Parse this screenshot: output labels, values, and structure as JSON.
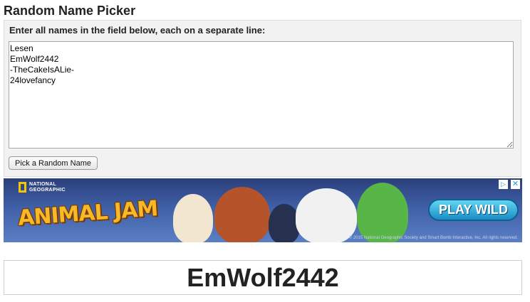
{
  "page": {
    "title": "Random Name Picker"
  },
  "picker": {
    "instructions": "Enter all names in the field below, each on a separate line:",
    "names_value": "Lesen\nEmWolf2442\n-TheCakeIsALie-\n24lovefancy",
    "button_label": "Pick a Random Name"
  },
  "ad": {
    "brand_badge": "NATIONAL GEOGRAPHIC",
    "logo_text": "ANIMAL JAM",
    "cta_label": "PLAY WILD",
    "adchoices_icon": "adchoices-icon",
    "close_icon": "close-icon",
    "close_glyph": "✕",
    "adchoices_glyph": "▷",
    "copyright": "© 2015 National Geographic Society and Smart Bomb Interactive, Inc. All rights reserved."
  },
  "result": {
    "picked_name": "EmWolf2442"
  }
}
